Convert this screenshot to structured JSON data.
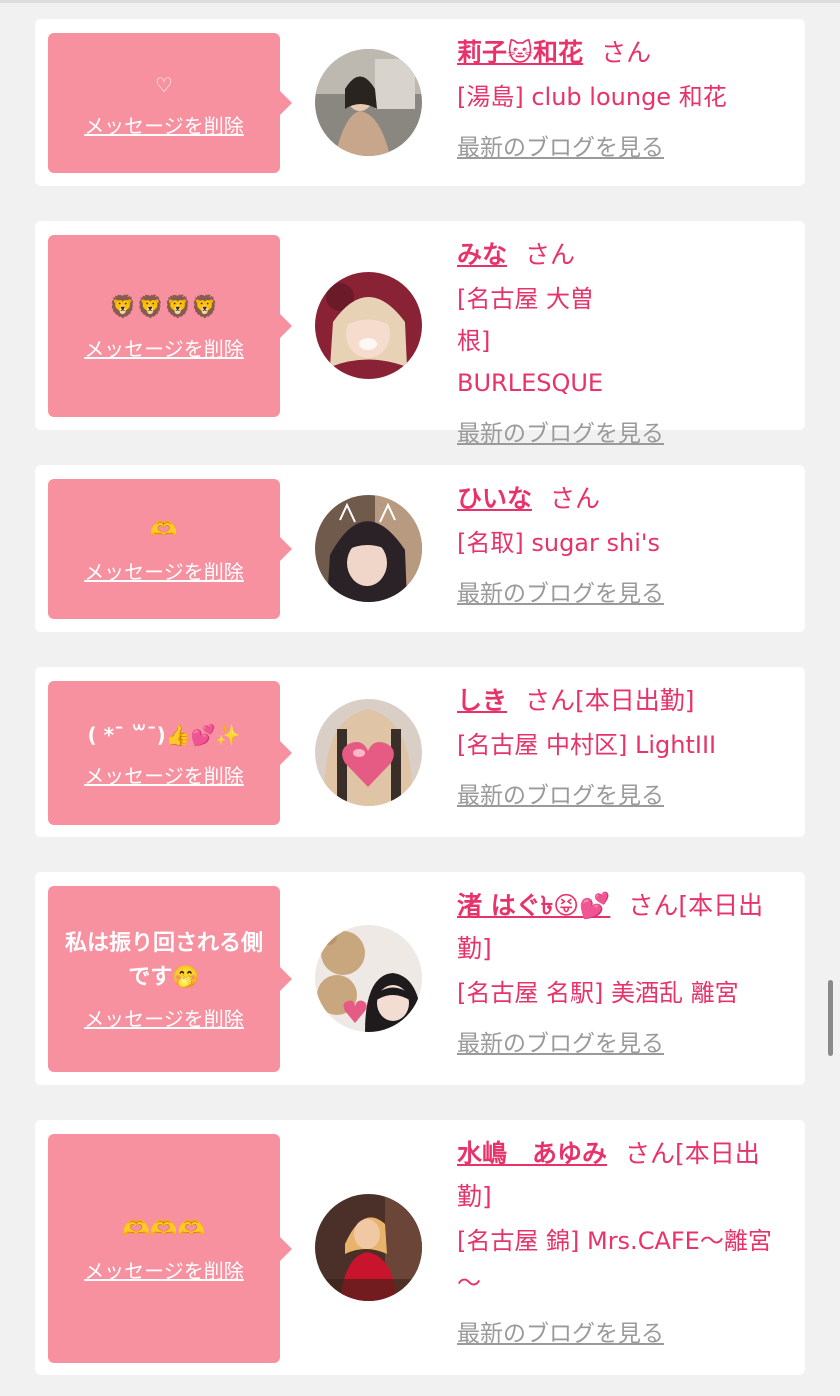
{
  "delete_label": "メッセージを削除",
  "san_label": "さん",
  "blog_label": "最新のブログを見る",
  "cards": [
    {
      "message": "♡",
      "name": "莉子🐱和花",
      "name_suffix": "",
      "shop": "[湯島] club lounge 和花",
      "avatar_icon": "portrait-woman-beige-dress"
    },
    {
      "message": "🦁🦁🦁🦁",
      "name": "みな",
      "name_suffix": "",
      "shop": "[名古屋 大曽根] BURLESQUE",
      "avatar_icon": "portrait-blonde-cat-filter"
    },
    {
      "message": "🫶",
      "name": "ひいな",
      "name_suffix": "",
      "shop": "[名取] sugar shi's",
      "avatar_icon": "portrait-cat-ears"
    },
    {
      "message": "( *¯ ꒳¯)👍💕✨",
      "name": "しき",
      "name_suffix": "[本日出勤]",
      "shop": "[名古屋 中村区] LightIII",
      "avatar_icon": "portrait-heart-sticker"
    },
    {
      "message": "私は振り回される側です🤭",
      "name": "渚 はぐ৳😝💕",
      "name_suffix": "[本日出勤]",
      "shop": "[名古屋 名駅] 美酒乱 離宮",
      "avatar_icon": "portrait-teddy-bear"
    },
    {
      "message": "🫶🫶🫶",
      "name": "水嶋　あゆみ",
      "name_suffix": "[本日出勤]",
      "shop": "[名古屋 錦] Mrs.CAFE～離宮～",
      "avatar_icon": "portrait-red-dress"
    }
  ]
}
